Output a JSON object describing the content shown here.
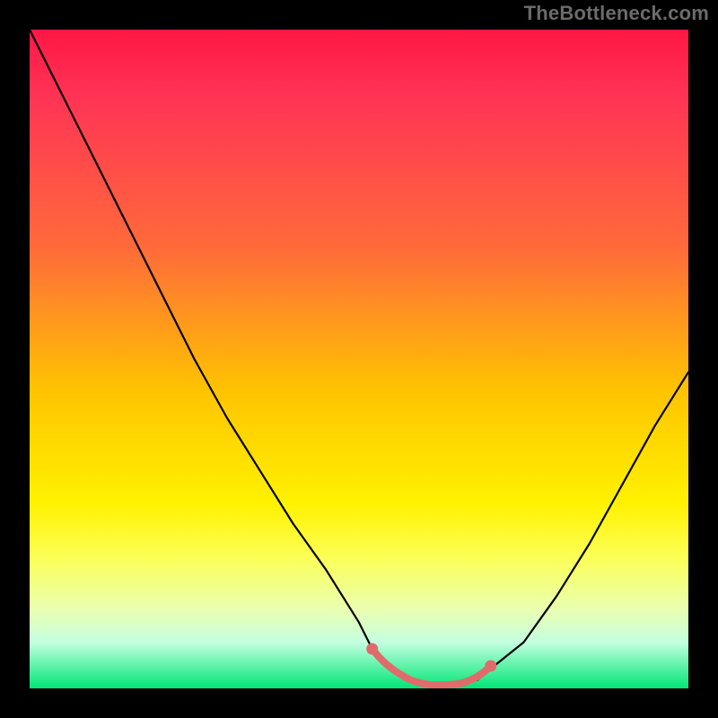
{
  "watermark": "TheBottleneck.com",
  "chart_data": {
    "type": "line",
    "title": "",
    "xlabel": "",
    "ylabel": "",
    "xlim": [
      0,
      100
    ],
    "ylim": [
      0,
      100
    ],
    "gradient_stops": [
      {
        "pos": 0,
        "color": "#ff1744",
        "meaning": "high-bottleneck"
      },
      {
        "pos": 33,
        "color": "#ff6a3a"
      },
      {
        "pos": 55,
        "color": "#ffc400"
      },
      {
        "pos": 80,
        "color": "#fcff55"
      },
      {
        "pos": 100,
        "color": "#00e676",
        "meaning": "no-bottleneck"
      }
    ],
    "series": [
      {
        "name": "bottleneck-curve",
        "color": "#000000",
        "x": [
          0,
          5,
          10,
          15,
          20,
          25,
          30,
          35,
          40,
          45,
          50,
          52,
          55,
          58,
          60,
          63,
          65,
          68,
          70,
          75,
          80,
          85,
          90,
          95,
          100
        ],
        "y": [
          100,
          90,
          80,
          70,
          60,
          50,
          41,
          33,
          25,
          18,
          10,
          6,
          3,
          1.2,
          0.7,
          0.5,
          0.7,
          1.3,
          3,
          7,
          14,
          22,
          31,
          40,
          48
        ]
      },
      {
        "name": "optimal-zone-marker",
        "color": "#e06b6b",
        "x": [
          52,
          53,
          54,
          55,
          56,
          57,
          58,
          59,
          60,
          61,
          62,
          63,
          64,
          65,
          66,
          67,
          68,
          69,
          70
        ],
        "y": [
          6.0,
          4.8,
          3.8,
          3.0,
          2.3,
          1.7,
          1.2,
          0.9,
          0.7,
          0.5,
          0.5,
          0.5,
          0.6,
          0.7,
          0.9,
          1.3,
          1.8,
          2.5,
          3.4
        ]
      }
    ],
    "optimal_range_x": [
      52,
      70
    ],
    "annotations": []
  }
}
